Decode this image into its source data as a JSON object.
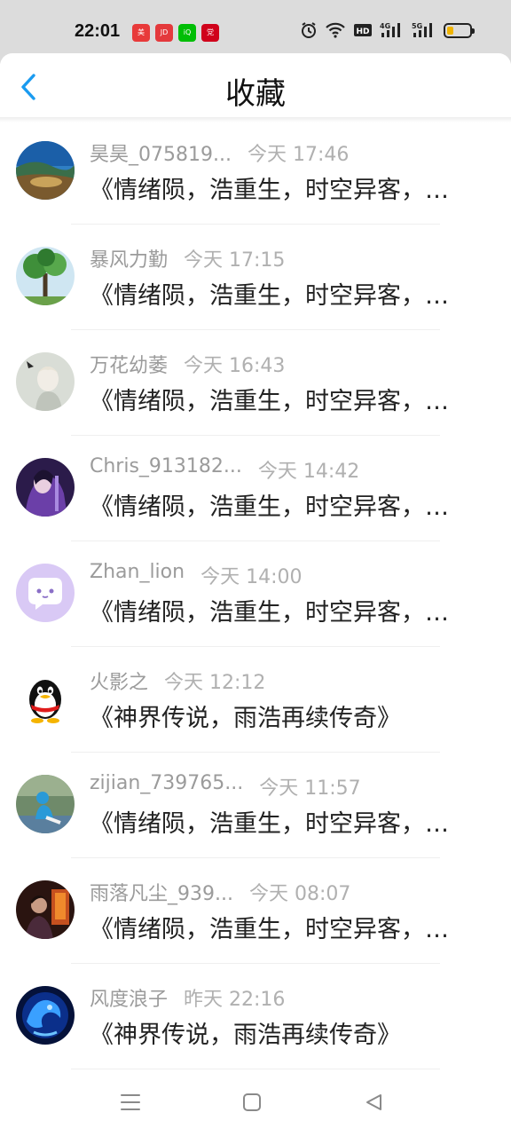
{
  "status_bar": {
    "time": "22:01",
    "apps": [
      {
        "name": "app-icon-1",
        "color": "#e83a3a",
        "label": "美"
      },
      {
        "name": "app-icon-2",
        "color": "#e4393c",
        "label": "JD"
      },
      {
        "name": "app-icon-3",
        "color": "#00be06",
        "label": "iQ"
      },
      {
        "name": "app-icon-4",
        "color": "#d0021b",
        "label": "党"
      }
    ],
    "battery_level": 0.3,
    "network_labels": [
      "HD",
      "4G",
      "5G"
    ]
  },
  "header": {
    "title": "收藏",
    "back_icon": "chevron-left-icon",
    "accent_color": "#1a9bf0"
  },
  "items": [
    {
      "user": "昊昊_075819...",
      "time": "今天 17:46",
      "title": "《情绪陨，浩重生，时空异客，无限",
      "avatar": "landscape"
    },
    {
      "user": "暴风力勤",
      "time": "今天 17:15",
      "title": "《情绪陨，浩重生，时空异客，无限",
      "avatar": "tree"
    },
    {
      "user": "万花幼萎",
      "time": "今天 16:43",
      "title": "《情绪陨，浩重生，时空异客，无限",
      "avatar": "anime-white"
    },
    {
      "user": "Chris_913182...",
      "time": "今天 14:42",
      "title": "《情绪陨，浩重生，时空异客，无限",
      "avatar": "anime-purple"
    },
    {
      "user": "Zhan_lion",
      "time": "今天 14:00",
      "title": "《情绪陨，浩重生，时空异客，无限",
      "avatar": "chat-bubble"
    },
    {
      "user": "火影之",
      "time": "今天 12:12",
      "title": "《神界传说，雨浩再续传奇》",
      "avatar": "penguin"
    },
    {
      "user": "zijian_739765...",
      "time": "今天 11:57",
      "title": "《情绪陨，浩重生，时空异客，无限",
      "avatar": "person-outdoor"
    },
    {
      "user": "雨落凡尘_939...",
      "time": "今天 08:07",
      "title": "《情绪陨，浩重生，时空异客，无限",
      "avatar": "dark-scene"
    },
    {
      "user": "风度浪子",
      "time": "昨天 22:16",
      "title": "《神界传说，雨浩再续传奇》",
      "avatar": "blue-dragon"
    }
  ],
  "nav_bar": {
    "menu_icon": "menu-icon",
    "home_icon": "home-square-icon",
    "back_icon": "back-triangle-icon"
  }
}
